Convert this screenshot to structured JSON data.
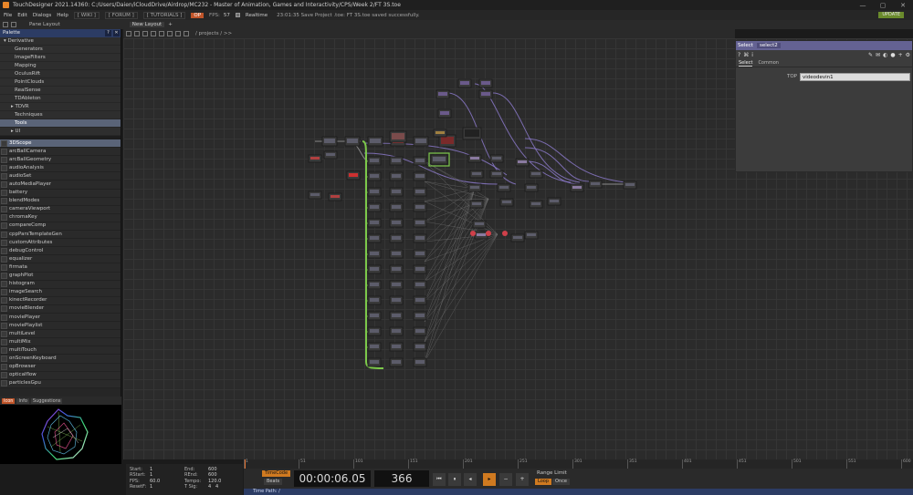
{
  "app": {
    "title": "TouchDesigner 2021.14360: C:/Users/Daien/iCloudDrive/Airdrop/MC232 - Master of Animation, Games and Interactivity/CPS/Week 2/FT 3S.toe",
    "minimize": "—",
    "maximize": "▢",
    "close": "✕"
  },
  "menubar": {
    "menus": [
      "File",
      "Edit",
      "Dialogs",
      "Help"
    ],
    "wiki": "[ WIKI ]",
    "forum": "[ FORUM ]",
    "tutorials": "[ TUTORIALS ]",
    "oper_badge": "OP",
    "fps_label": "FPS:",
    "fps_value": "57",
    "realtime_label": "Realtime",
    "status_message": "23:01:35 Save Project .toe: FT 3S.toe saved successfully.",
    "update_label": "UPDATE"
  },
  "toolbar": {
    "pane_layout": "Pane Layout",
    "layout_tab": "New Layout",
    "add_tab": "+"
  },
  "palette": {
    "header": "Palette",
    "help_btn": "?",
    "close_btn": "✕",
    "tree": [
      {
        "label": "▾ Derivative",
        "indent": 1
      },
      {
        "label": "Generators",
        "indent": 4
      },
      {
        "label": "ImageFilters",
        "indent": 4
      },
      {
        "label": "Mapping",
        "indent": 4
      },
      {
        "label": "OculusRift",
        "indent": 4
      },
      {
        "label": "PointClouds",
        "indent": 4
      },
      {
        "label": "RealSense",
        "indent": 4
      },
      {
        "label": "TDAbleton",
        "indent": 4
      },
      {
        "label": "▸ TDVR",
        "indent": 3
      },
      {
        "label": "Techniques",
        "indent": 4
      },
      {
        "label": "Tools",
        "indent": 4,
        "selected": true
      },
      {
        "label": "▸ UI",
        "indent": 3
      }
    ],
    "components": [
      "3DScope",
      "arcBallCamera",
      "arcBallGeometry",
      "audioAnalysis",
      "audioSet",
      "autoMediaPlayer",
      "battery",
      "blendModes",
      "cameraViewport",
      "chromaKey",
      "compareComp",
      "cppParsTemplateGen",
      "customAttributes",
      "debugControl",
      "equalizer",
      "firmata",
      "graphPlot",
      "histogram",
      "imageSearch",
      "kinectRecorder",
      "movieBlender",
      "moviePlayer",
      "moviePlaylist",
      "multiLevel",
      "multiMix",
      "multiTouch",
      "onScreenKeyboard",
      "opBrowser",
      "opticalflow",
      "particlesGpu"
    ],
    "selected_component": "3DScope"
  },
  "preview_tabs": [
    "Icon",
    "Info",
    "Suggestions"
  ],
  "network": {
    "path": "/ projects / >>"
  },
  "params": {
    "op_type": "Select",
    "op_name": "select2",
    "tabs": [
      "Select",
      "Common"
    ],
    "top_label": "TOP",
    "top_value": "videodevin1"
  },
  "timeline": {
    "ticks": [
      "1",
      "51",
      "101",
      "151",
      "201",
      "251",
      "301",
      "351",
      "401",
      "451",
      "501",
      "551",
      "600"
    ]
  },
  "status": {
    "start_label": "Start:",
    "start": "1",
    "end_label": "End:",
    "end": "600",
    "rstart_label": "RStart:",
    "rstart": "1",
    "rend_label": "REnd:",
    "rend": "600",
    "fps_label": "FPS:",
    "fps": "60.0",
    "tempo_label": "Tempo:",
    "tempo": "120.0",
    "resetf_label": "ResetF:",
    "resetf": "1",
    "tsig_label": "T Sig:",
    "tsig_a": "4",
    "tsig_b": "4"
  },
  "transport": {
    "timecode_btn": "TimeCode",
    "beats_btn": "Beats",
    "timecode": "00:00:06.05",
    "frame": "366",
    "btn_start": "⏮",
    "btn_pause": "⏸",
    "btn_back": "◂",
    "btn_play": "▸",
    "btn_minus": "−",
    "btn_plus": "+",
    "range_limit": "Range Limit",
    "loop": "Loop",
    "once": "Once"
  },
  "pathbar": {
    "label": "Time Path: /"
  },
  "colors": {
    "accent_orange": "#d07a20",
    "palette_header_blue": "#2c3c64",
    "param_header_purple": "#646293",
    "wire_purple": "#8a78c8",
    "wire_green": "#7cc84a"
  }
}
